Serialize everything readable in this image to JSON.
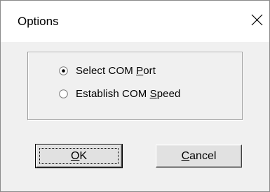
{
  "window": {
    "title": "Options",
    "close_glyph": "✕"
  },
  "group": {
    "options": [
      {
        "label_pre": "Select COM ",
        "label_accel": "P",
        "label_post": "ort",
        "checked": true
      },
      {
        "label_pre": "Establish COM ",
        "label_accel": "S",
        "label_post": "peed",
        "checked": false
      }
    ]
  },
  "buttons": {
    "ok": {
      "accel": "O",
      "rest": "K"
    },
    "cancel": {
      "accel": "C",
      "rest": "ancel"
    }
  },
  "icons": {
    "close": "close-icon",
    "radio_selected": "radio-selected-icon",
    "radio_unselected": "radio-unselected-icon"
  }
}
